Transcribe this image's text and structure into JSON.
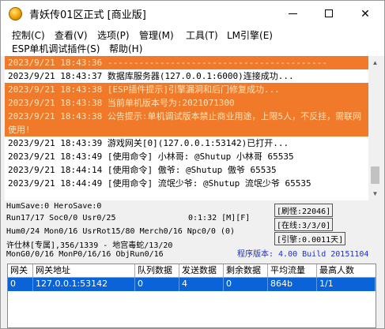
{
  "window": {
    "title": "青妖传01区正式 [商业版]",
    "icon": "app-coin-icon",
    "controls": {
      "minimize": "minimize-icon",
      "maximize": "maximize-icon",
      "close": "✕"
    }
  },
  "menu": {
    "row1": [
      "控制(C)",
      "查看(V)",
      "选项(P)",
      "管理(M)",
      "工具(T)",
      "LM引擎(E)"
    ],
    "row2": [
      "ESP单机调试插件(S)",
      "帮助(H)"
    ]
  },
  "log": {
    "lines": [
      {
        "text": "2023/9/21 18:43:36 ------------------------------------------",
        "style": "warn"
      },
      {
        "text": "2023/9/21 18:43:37 数据库服务器(127.0.0.1:6000)连接成功...",
        "style": "normal"
      },
      {
        "text": "2023/9/21 18:43:38 [ESP插件提示]引擎漏洞和后门修复成功...",
        "style": "warn"
      },
      {
        "text": "2023/9/21 18:43:38 当前单机版本号为:2021071300",
        "style": "warn"
      },
      {
        "text": "2023/9/21 18:43:38 公告提示:单机调试版本禁止商业用途，上限5人，不反挂，需联网使用!",
        "style": "warn-tall"
      },
      {
        "text": "2023/9/21 18:43:39 游戏网关[0](127.0.0.1:53142)已打开...",
        "style": "normal"
      },
      {
        "text": "2023/9/21 18:43:49 [使用命令] 小林哥: @Shutup 小林哥 65535",
        "style": "normal"
      },
      {
        "text": "2023/9/21 18:44:14 [使用命令] 傲爷: @Shutup 傲爷 65535",
        "style": "normal"
      },
      {
        "text": "2023/9/21 18:44:49 [使用命令] 流氓少爷: @Shutup 流氓少爷 65535",
        "style": "normal"
      }
    ]
  },
  "status": {
    "line1": "HumSave:0 HeroSave:0",
    "line2": "Run17/17 Soc0/0 Usr0/25",
    "timer": "0:1:32 [M][F]",
    "line3": "Hum0/24 Mon0/16 UsrRot15/80 Merch0/16 Npc0/0 (0)",
    "line4": "许仕林[专属],356/1339 - 地宫毒蛇/13/20",
    "line5": "MonG0/0/16 MonP0/16/16 ObjRun0/16",
    "refresh": "[刷怪:22046]",
    "online": "[在线:3/3/0]",
    "engine": "[引擎:0.0011天]",
    "version": "程序版本: 4.00 Build 20151104"
  },
  "gateway_table": {
    "headers": [
      "网关",
      "网关地址",
      "队列数据",
      "发送数据",
      "剩余数据",
      "平均流量",
      "最高人数"
    ],
    "rows": [
      [
        "0",
        "127.0.0.1:53142",
        "0",
        "4",
        "0",
        "864b",
        "1/1"
      ]
    ]
  },
  "colors": {
    "warn_bg": "#f07a2a",
    "selection_bg": "#0a64d8",
    "version_text": "#1b2fd6"
  }
}
